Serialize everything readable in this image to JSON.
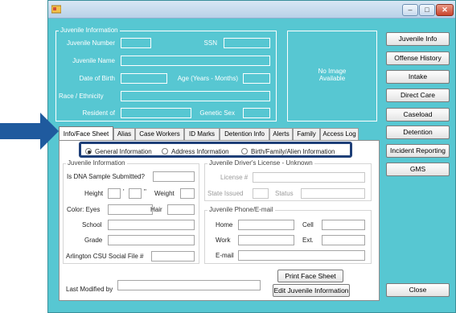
{
  "colors": {
    "window_bg": "#57c7d2",
    "arrow": "#1f5a9e",
    "highlight": "#1e3f78"
  },
  "juvenile_information": {
    "legend": "Juvenile Information",
    "juvenile_number_label": "Juvenile Number",
    "ssn_label": "SSN",
    "juvenile_name_label": "Juvenile Name",
    "dob_label": "Date of Birth",
    "age_label": "Age (Years - Months)",
    "race_label": "Race / Ethnicity",
    "resident_label": "Resident of",
    "genetic_sex_label": "Genetic Sex"
  },
  "image": {
    "no_image_text": "No Image\nAvailable"
  },
  "nav": {
    "buttons": [
      "Juvenile Info",
      "Offense History",
      "Intake",
      "Direct Care",
      "Caseload",
      "Detention",
      "Incident Reporting",
      "GMS"
    ],
    "close": "Close"
  },
  "tabs": [
    "Info/Face Sheet",
    "Alias",
    "Case Workers",
    "ID Marks",
    "Detention Info",
    "Alerts",
    "Family",
    "Access Log"
  ],
  "radios": [
    {
      "label": "General Information",
      "selected": true
    },
    {
      "label": "Address Information",
      "selected": false
    },
    {
      "label": "Birth/Family/Alien Information",
      "selected": false
    }
  ],
  "panel": {
    "juvenile_info_legend": "Juvenile Information",
    "dna_label": "Is DNA Sample Submitted?",
    "height_label": "Height",
    "feet_mark": "'",
    "inch_mark": "\"",
    "weight_label": "Weight",
    "color_eyes_label": "Color: Eyes",
    "hair_label": "Hair",
    "school_label": "School",
    "grade_label": "Grade",
    "csu_label": "Arlington CSU Social File #",
    "license_legend": "Juvenile Driver's License - Unknown",
    "license_label": "License #",
    "state_label": "State Issued",
    "status_label": "Status",
    "phone_legend": "Juvenile Phone/E-mail",
    "home_label": "Home",
    "cell_label": "Cell",
    "work_label": "Work",
    "ext_label": "Ext.",
    "email_label": "E-mail",
    "print_button": "Print Face Sheet",
    "edit_button": "Edit Juvenile Information",
    "last_modified_label": "Last Modified by"
  }
}
